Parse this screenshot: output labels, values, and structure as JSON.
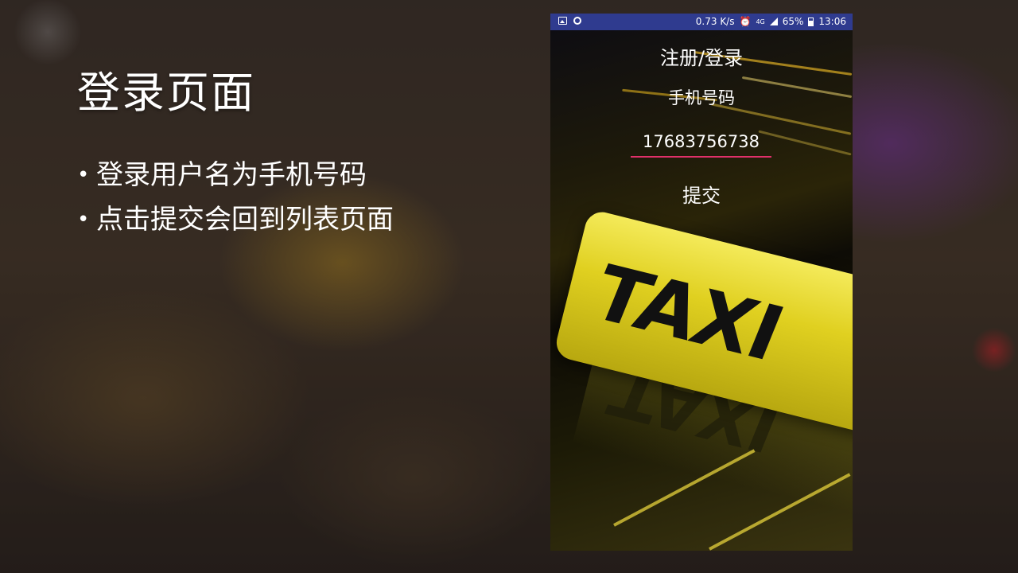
{
  "slide": {
    "title": "登录页面",
    "bullets": [
      "登录用户名为手机号码",
      "点击提交会回到列表页面"
    ]
  },
  "phone": {
    "statusbar": {
      "speed": "0.73 K/s",
      "network": "4G",
      "battery": "65%",
      "time": "13:06",
      "icons": [
        "image-icon",
        "circle-notification-icon",
        "alarm-icon",
        "signal-icon",
        "battery-icon"
      ]
    },
    "app": {
      "title": "注册/登录",
      "field_label": "手机号码",
      "phone_value": "17683756738",
      "submit_label": "提交",
      "accent_color": "#e0306a"
    },
    "background_sign": "TAXI"
  }
}
